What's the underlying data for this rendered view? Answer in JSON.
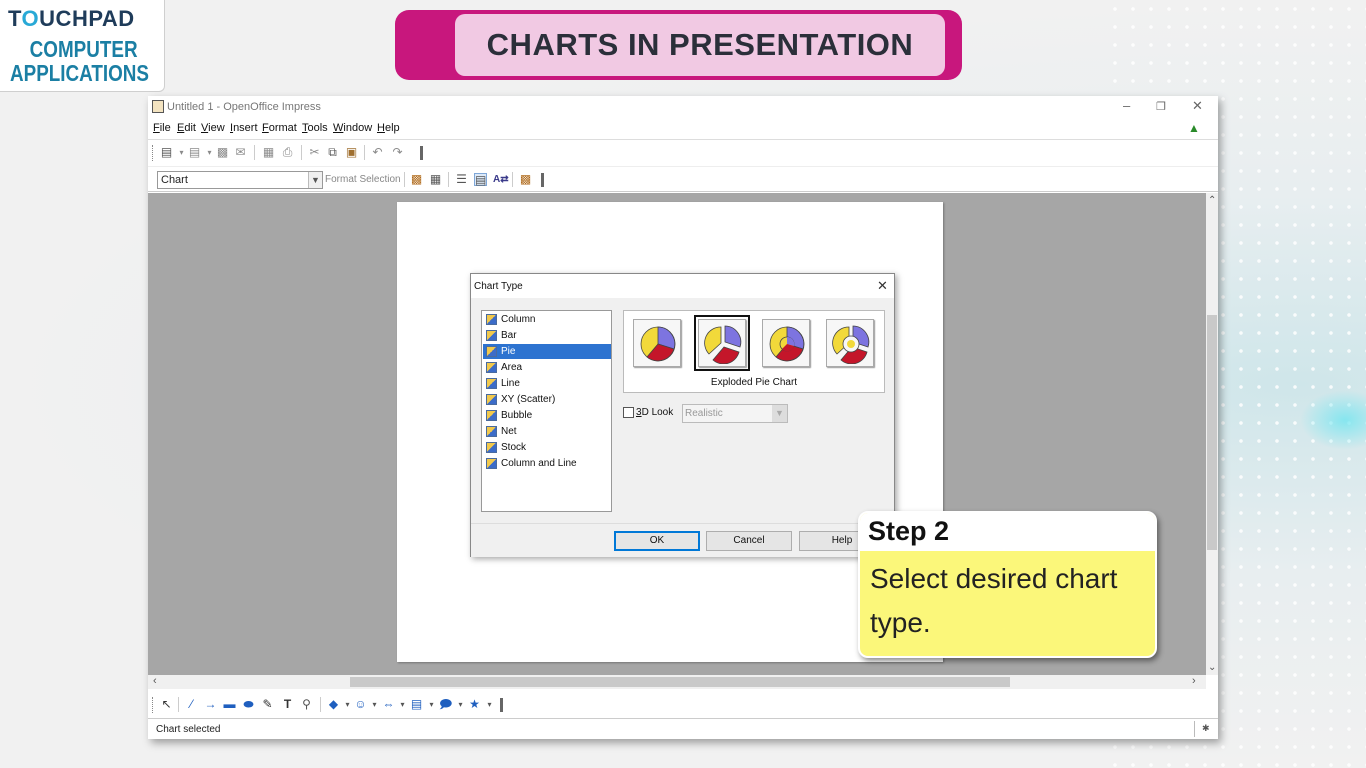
{
  "logo": {
    "brand_left": "T",
    "brand_o": "O",
    "brand_right": "UCHPAD",
    "line1": "COMPUTER",
    "line2": "APPLICATIONS"
  },
  "banner": {
    "title": "CHARTS IN PRESENTATION"
  },
  "window": {
    "title": "Untitled 1 - OpenOffice Impress",
    "menu": [
      "File",
      "Edit",
      "View",
      "Insert",
      "Format",
      "Tools",
      "Window",
      "Help"
    ],
    "toolbar2": {
      "combo_value": "Chart",
      "format_selection": "Format Selection"
    },
    "status": "Chart selected"
  },
  "dialog": {
    "title": "Chart Type",
    "chart_types": [
      "Column",
      "Bar",
      "Pie",
      "Area",
      "Line",
      "XY (Scatter)",
      "Bubble",
      "Net",
      "Stock",
      "Column and Line"
    ],
    "selected_type": "Pie",
    "variant_label": "Exploded Pie Chart",
    "look_label": "3D Look",
    "look_option": "Realistic",
    "ok": "OK",
    "cancel": "Cancel",
    "help": "Help"
  },
  "callout": {
    "heading": "Step 2",
    "body": "Select desired chart type."
  },
  "colors": {
    "banner": "#c8177d",
    "banner_inner": "#f1c9e3",
    "callout": "#fbf77a",
    "selection": "#2d73d0"
  }
}
